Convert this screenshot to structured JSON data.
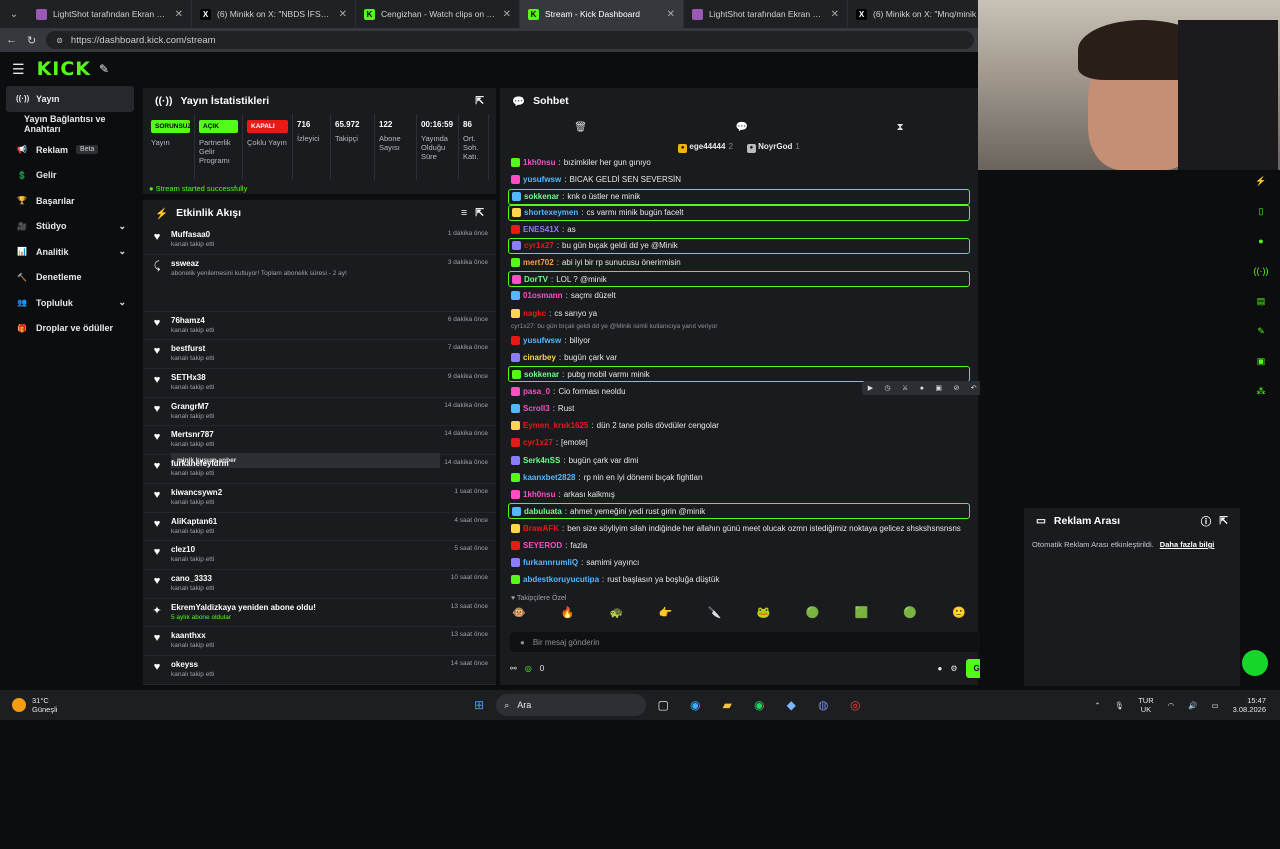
{
  "browser": {
    "tabs": [
      {
        "title": "LightShot tarafından Ekran Görün",
        "icon": "lightshot-icon",
        "color": "#9b59b6"
      },
      {
        "title": "(6) Minikk on X: \"NBDS İFSA :) http",
        "icon": "x-icon",
        "color": "#ffffff"
      },
      {
        "title": "Cengizhan - Watch clips on Kick",
        "icon": "kick-icon",
        "color": "#53fc18"
      },
      {
        "title": "Stream - Kick Dashboard",
        "icon": "kick-icon",
        "color": "#53fc18"
      },
      {
        "title": "LightShot tarafından Ekran Görün",
        "icon": "lightshot-icon",
        "color": "#9b59b6"
      },
      {
        "title": "(6) Minikk on X: \"Mnq/minik https",
        "icon": "x-icon",
        "color": "#ffffff"
      }
    ],
    "url": "https://dashboard.kick.com/stream"
  },
  "brand": {
    "logo": "KICK",
    "beta": "BETA"
  },
  "sidebar": {
    "items": [
      {
        "label": "Yayın",
        "icon": "broadcast-icon"
      },
      {
        "label": "Yayın Bağlantısı ve Anahtarı",
        "icon": ""
      },
      {
        "label": "Reklam",
        "icon": "megaphone-icon",
        "badge": "Beta"
      },
      {
        "label": "Gelir",
        "icon": "money-icon"
      },
      {
        "label": "Başarılar",
        "icon": "trophy-icon"
      },
      {
        "label": "Stüdyo",
        "icon": "studio-icon",
        "chevron": true
      },
      {
        "label": "Analitik",
        "icon": "chart-icon",
        "chevron": true
      },
      {
        "label": "Denetleme",
        "icon": "hammer-icon"
      },
      {
        "label": "Topluluk",
        "icon": "community-icon",
        "chevron": true
      },
      {
        "label": "Droplar ve ödüller",
        "icon": "gift-icon"
      }
    ]
  },
  "stats": {
    "title": "Yayın İstatistikleri",
    "cells": [
      {
        "value": "SORUNSUZ",
        "label": "Yayın",
        "badge": "#53fc18"
      },
      {
        "value": "AÇIK",
        "label": "Partnerlik Gelir Programı",
        "badge": "#53fc18"
      },
      {
        "value": "KAPALI",
        "label": "Çoklu Yayın",
        "badge": "#e91916"
      },
      {
        "value": "716",
        "label": "İzleyici"
      },
      {
        "value": "65.972",
        "label": "Takipçi"
      },
      {
        "value": "122",
        "label": "Abone Sayısı"
      },
      {
        "value": "00:16:59",
        "label": "Yayında Olduğu Süre"
      },
      {
        "value": "86",
        "label": "Ort. Soh. Katı."
      }
    ],
    "status": "Stream started successfully"
  },
  "activity": {
    "title": "Etkinlik Akışı",
    "items": [
      {
        "name": "Muffasaa0",
        "desc": "kanalı takip etti",
        "time": "1 dakika önce",
        "type": "follow"
      },
      {
        "name": "ssweaz",
        "desc": "abonelik yenilemesini kutluyor! Toplam abonelik süresi - 2 ay!",
        "time": "3 dakika önce",
        "type": "sub",
        "quote": "minik kuşum anber"
      },
      {
        "name": "76hamz4",
        "desc": "kanalı takip etti",
        "time": "6 dakika önce",
        "type": "follow"
      },
      {
        "name": "bestfurst",
        "desc": "kanalı takip etti",
        "time": "7 dakika önce",
        "type": "follow"
      },
      {
        "name": "SETHx38",
        "desc": "kanalı takip etti",
        "time": "9 dakika önce",
        "type": "follow"
      },
      {
        "name": "GrangrM7",
        "desc": "kanalı takip etti",
        "time": "14 dakika önce",
        "type": "follow"
      },
      {
        "name": "Mertsnr787",
        "desc": "kanalı takip etti",
        "time": "14 dakika önce",
        "type": "follow"
      },
      {
        "name": "furkanefeyldrm",
        "desc": "kanalı takip etti",
        "time": "14 dakika önce",
        "type": "follow"
      },
      {
        "name": "kiwancsywn2",
        "desc": "kanalı takip etti",
        "time": "1 saat önce",
        "type": "follow"
      },
      {
        "name": "AliKaptan61",
        "desc": "kanalı takip etti",
        "time": "4 saat önce",
        "type": "follow"
      },
      {
        "name": "clez10",
        "desc": "kanalı takip etti",
        "time": "5 saat önce",
        "type": "follow"
      },
      {
        "name": "cano_3333",
        "desc": "kanalı takip etti",
        "time": "10 saat önce",
        "type": "follow"
      },
      {
        "name": "EkremYaldizkaya yeniden abone oldu!",
        "desc": "5 aylık abone oldular",
        "time": "13 saat önce",
        "type": "resub"
      },
      {
        "name": "kaanthxx",
        "desc": "kanalı takip etti",
        "time": "13 saat önce",
        "type": "follow"
      },
      {
        "name": "okeyss",
        "desc": "kanalı takip etti",
        "time": "14 saat önce",
        "type": "follow"
      }
    ]
  },
  "chat": {
    "title": "Sohbet",
    "pinned": [
      {
        "name": "ege44444",
        "count": "2"
      },
      {
        "name": "NoyrGod",
        "count": "1"
      }
    ],
    "messages": [
      {
        "user": "1kh0nsu",
        "color": "#ff4dc4",
        "text": "bızimkiler her gun gınıyo",
        "hl": false
      },
      {
        "user": "yusufwsw",
        "color": "#53b8ff",
        "text": "BICAK GELDİ SEN SEVERSİN",
        "hl": false
      },
      {
        "user": "sokkenar",
        "color": "#6dff8a",
        "text": "knk o üstler ne minik",
        "hl": true
      },
      {
        "user": "shortexeymen",
        "color": "#53b8ff",
        "text": "cs varmı minik bugün facelt",
        "hl": true
      },
      {
        "user": "ENES41X",
        "color": "#8a7dff",
        "text": "as",
        "hl": false
      },
      {
        "user": "cyr1x27",
        "color": "#e91916",
        "text": "bu gün bıçak geldi dd ye @Minik",
        "hl": true
      },
      {
        "user": "mert702",
        "color": "#ff9f40",
        "text": "abi iyi bir rp sunucusu önerirmisin",
        "hl": false
      },
      {
        "user": "DorTV",
        "color": "#6dff8a",
        "text": "LOL ? @minik",
        "hl": true
      },
      {
        "user": "01osmann",
        "color": "#ff4dc4",
        "text": "saçmı düzelt",
        "hl": false
      },
      {
        "user": "nagkc",
        "color": "#e91916",
        "text": "cs sarıyo ya",
        "hl": false
      },
      {
        "user": "yusufwsw",
        "color": "#53b8ff",
        "text": "biliyor",
        "hl": false,
        "reply": "cyr1x27: bu gün bıçak geldi dd ye @Minik isimli kullanıcıya yanıt veriyor"
      },
      {
        "user": "cinarbey",
        "color": "#ffd54a",
        "text": "bugün çark var",
        "hl": false
      },
      {
        "user": "sokkenar",
        "color": "#6dff8a",
        "text": "pubg mobil varmı minik",
        "hl": true
      },
      {
        "user": "pasa_0",
        "color": "#ff4dc4",
        "text": "Cio forması neoldu",
        "hl": false
      },
      {
        "user": "Scroll3",
        "color": "#ff4dc4",
        "text": "Rust",
        "hl": false
      },
      {
        "user": "Eymen_kruk1625",
        "color": "#e91916",
        "text": "dün 2 tane polis dövdüler cengolar",
        "hl": false
      },
      {
        "user": "cyr1x27",
        "color": "#e91916",
        "text": "[emote]",
        "hl": false
      },
      {
        "user": "Serk4nSS",
        "color": "#6dff8a",
        "text": "bugün çark var dimi",
        "hl": false
      },
      {
        "user": "kaanxbet2828",
        "color": "#53b8ff",
        "text": "rp nin en iyi dönemi bıçak fightları",
        "hl": false
      },
      {
        "user": "1kh0nsu",
        "color": "#ff4dc4",
        "text": "arkası kalkmış",
        "hl": false
      },
      {
        "user": "dabuluata",
        "color": "#6dff8a",
        "text": "ahmet yemeğini yedi rust girin @minik",
        "hl": true
      },
      {
        "user": "BrawAFK",
        "color": "#e91916",
        "text": "ben size söyliyim silah indiğinde her allahın günü meet olucak ozmn istediğimiz noktaya gelicez shskshsnsnsns",
        "hl": false
      },
      {
        "user": "SEYEROD",
        "color": "#ff4dc4",
        "text": "fazla",
        "hl": false
      },
      {
        "user": "furkannrumliQ",
        "color": "#53b8ff",
        "text": "samimi yayıncı",
        "hl": false
      },
      {
        "user": "abdestkoruyucutipa",
        "color": "#53b8ff",
        "text": "rust başlasın ya boşluğa düştük",
        "hl": false
      }
    ],
    "followers_only": "Takipçilere Özel",
    "placeholder": "Bir mesaj gönderin",
    "points": "0",
    "send": "Gönder"
  },
  "ad": {
    "title": "Reklam Arası",
    "text": "Otomatik Reklam Arası etkinleştirildi.",
    "link": "Daha fazla bilgi"
  },
  "taskbar": {
    "weather_temp": "31°C",
    "weather_text": "Güneşli",
    "search": "Ara",
    "lang1": "TUR",
    "lang2": "UK",
    "time": "15:47",
    "date": "3.08.2026"
  }
}
